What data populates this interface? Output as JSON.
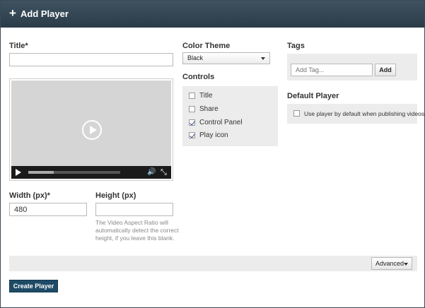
{
  "header": {
    "plus_glyph": "+",
    "title": "Add Player"
  },
  "title_field": {
    "label": "Title",
    "required_mark": "*",
    "value": ""
  },
  "preview": {
    "progress_fraction": 0.28,
    "volume_glyph": "🔊",
    "fullscreen_glyph": "⤡"
  },
  "width_field": {
    "label": "Width (px)",
    "required_mark": "*",
    "value": "480"
  },
  "height_field": {
    "label": "Height (px)",
    "value": "",
    "hint": "The Video Aspect Ratio will automatically detect the correct height, if you leave this blank."
  },
  "color_theme": {
    "label": "Color Theme",
    "selected": "Black"
  },
  "controls": {
    "label": "Controls",
    "items": [
      {
        "label": "Title",
        "checked": false
      },
      {
        "label": "Share",
        "checked": false
      },
      {
        "label": "Control Panel",
        "checked": true
      },
      {
        "label": "Play icon",
        "checked": true
      }
    ]
  },
  "tags": {
    "label": "Tags",
    "placeholder": "Add Tag...",
    "add_button": "Add"
  },
  "default_player": {
    "label": "Default Player",
    "checkbox_label": "Use player by default when publishing videos",
    "checked": false
  },
  "advanced_button": "Advanced",
  "create_button": "Create Player"
}
